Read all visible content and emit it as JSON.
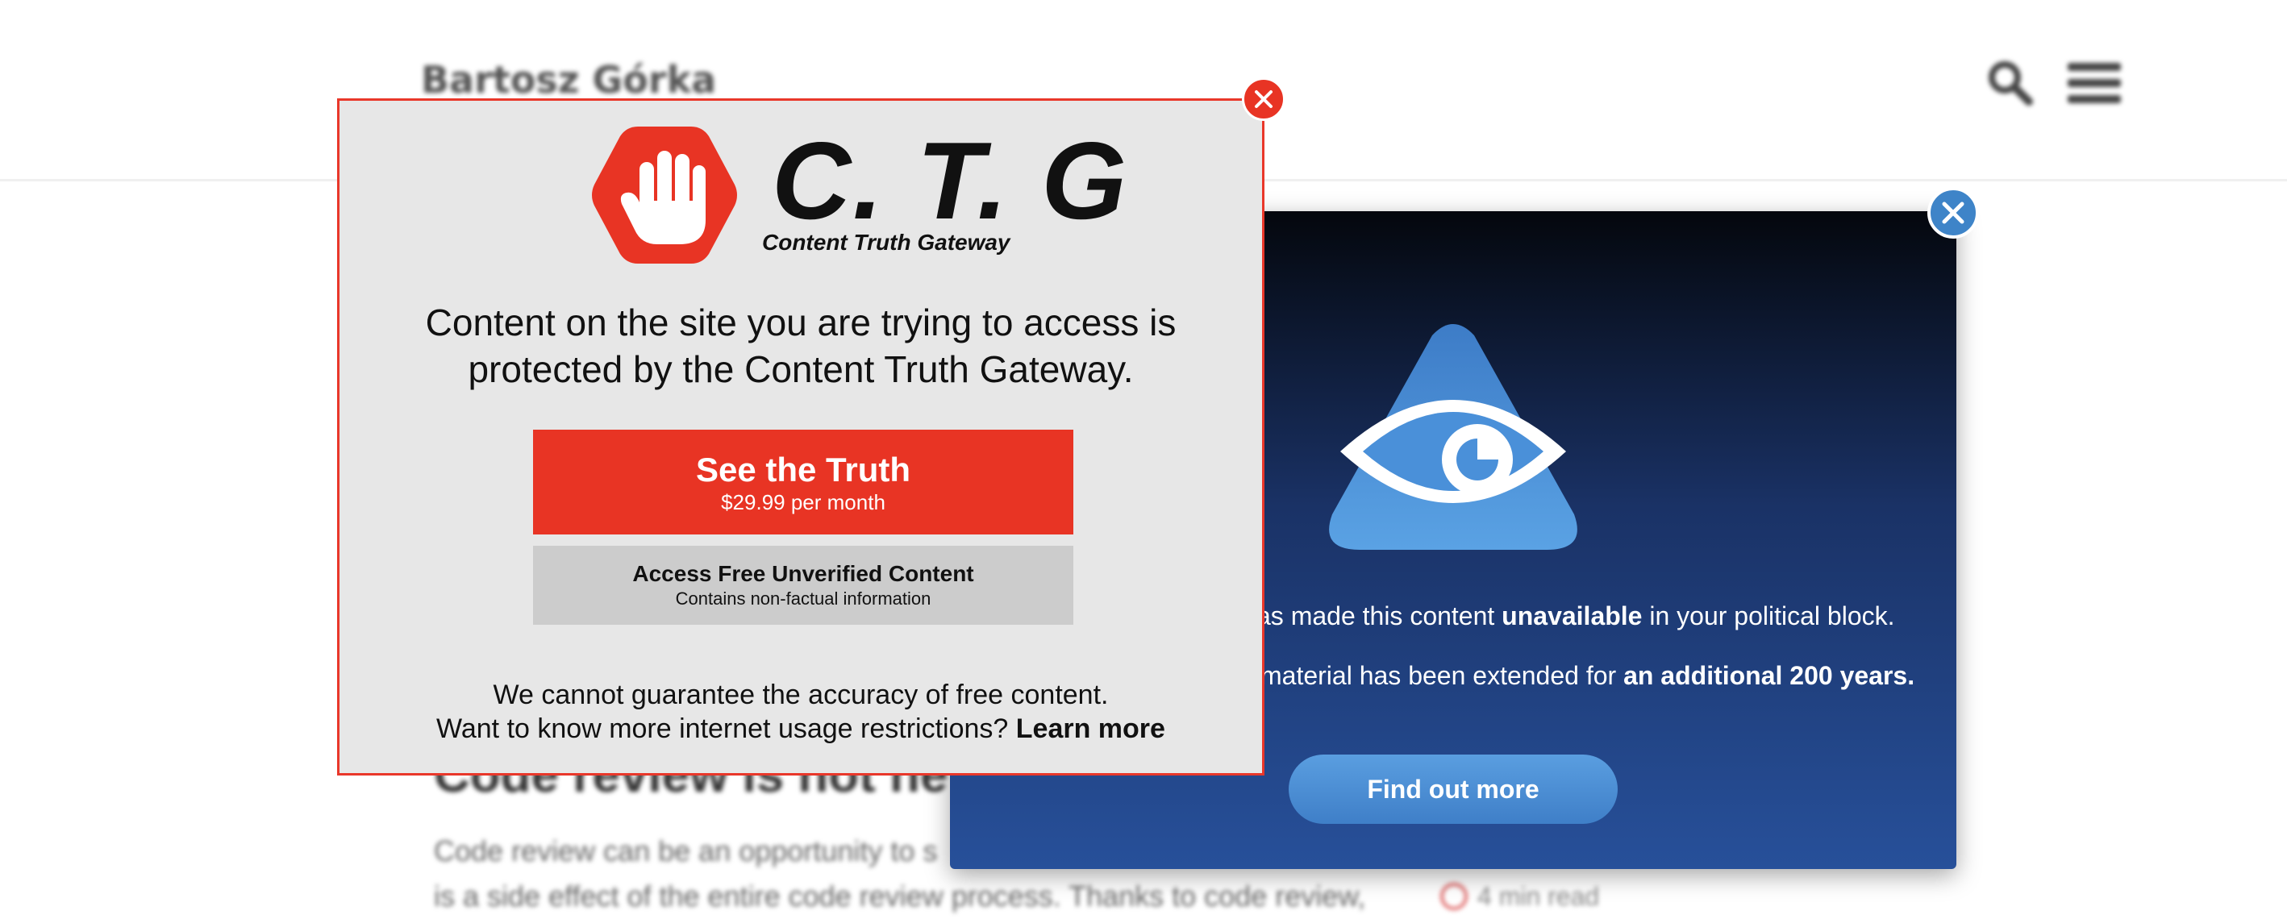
{
  "background_page": {
    "site_title": "Bartosz Górka",
    "article_title": "Code review is not ne",
    "article_lines": [
      "Code review can be an opportunity to s",
      "is a side effect of the entire code review process. Thanks to code review,"
    ],
    "read_time": "4 min read"
  },
  "dark_modal": {
    "line1_prefix": "as made this content ",
    "line1_bold": "unavailable",
    "line1_suffix": " in your political block.",
    "line2_prefix": "material has been extended for ",
    "line2_bold": "an additional 200 years.",
    "find_out_label": "Find out more",
    "colors": {
      "accent": "#3e84c8",
      "eye_logo": "#4a90d9"
    }
  },
  "ctg_modal": {
    "brand": "C. T. G",
    "tagline": "Content Truth Gateway",
    "heading_line1": "Content on the site you are trying to access is",
    "heading_line2": "protected by the Content Truth Gateway.",
    "primary_button": {
      "label": "See the Truth",
      "price": "$29.99 per month"
    },
    "secondary_button": {
      "label": "Access Free Unverified Content",
      "note": "Contains non-factual information"
    },
    "footer_line1": "We cannot guarantee the accuracy of free content.",
    "footer_line2_prefix": "Want to know more internet usage restrictions? ",
    "learn_more_label": "Learn more",
    "colors": {
      "accent": "#e83424",
      "panel": "#e7e7e7"
    }
  },
  "icons": [
    "stop-hand-icon",
    "all-seeing-eye-icon",
    "search-icon",
    "menu-icon",
    "close-icon",
    "clock-icon"
  ]
}
